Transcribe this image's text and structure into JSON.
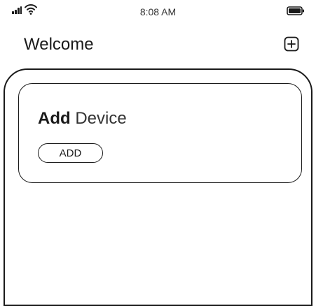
{
  "status_bar": {
    "time": "8:08 AM",
    "icons": [
      "signal-icon",
      "wifi-icon",
      "battery-icon"
    ]
  },
  "header": {
    "title": "Welcome",
    "action_icon": "plus-square-icon"
  },
  "device_card": {
    "title_bold": "Add",
    "title_rest": " Device",
    "button_label": "ADD"
  },
  "colors": {
    "ink": "#1a1a1a",
    "background": "#ffffff"
  }
}
